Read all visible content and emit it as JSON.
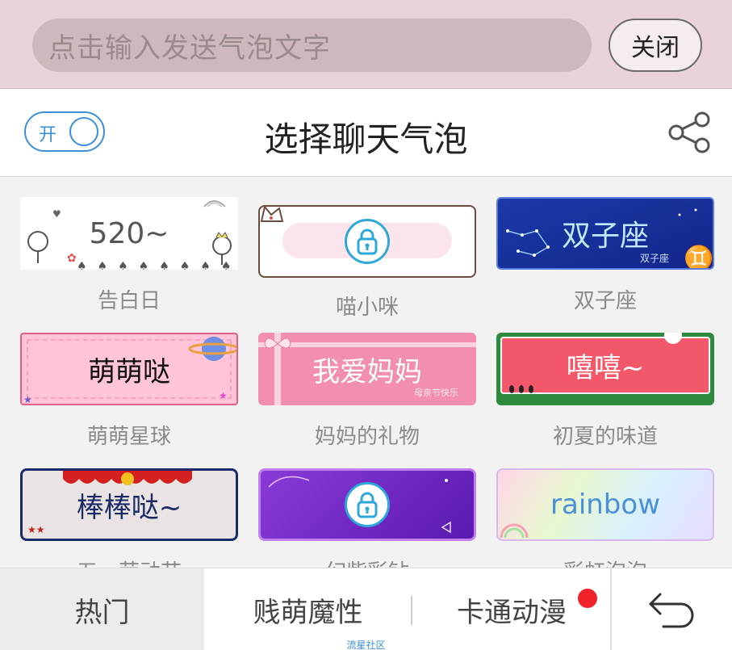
{
  "top_bar": {
    "input_placeholder": "点击输入发送气泡文字",
    "close_label": "关闭"
  },
  "header": {
    "toggle_label": "开",
    "title": "选择聊天气泡"
  },
  "bubbles": [
    {
      "label": "告白日",
      "text": "520~"
    },
    {
      "label": "喵小咪",
      "locked": true
    },
    {
      "label": "双子座",
      "text": "双子座",
      "subtext": "双子座"
    },
    {
      "label": "萌萌星球",
      "text": "萌萌哒"
    },
    {
      "label": "妈妈的礼物",
      "text": "我爱妈妈",
      "subtext": "母亲节快乐"
    },
    {
      "label": "初夏的味道",
      "text": "嘻嘻~"
    },
    {
      "label": "五一劳动节",
      "text": "棒棒哒~"
    },
    {
      "label": "幻紫彩钻",
      "locked": true
    },
    {
      "label": "彩虹泡泡",
      "text": "rainbow"
    }
  ],
  "tabs": {
    "hot": "热门",
    "jianmeng": "贱萌魔性",
    "cartoon": "卡通动漫"
  },
  "watermark": "流星社区",
  "colors": {
    "accent_blue": "#3b8fd9",
    "badge_red": "#f0232b",
    "top_bar_bg": "#ead3d6"
  }
}
